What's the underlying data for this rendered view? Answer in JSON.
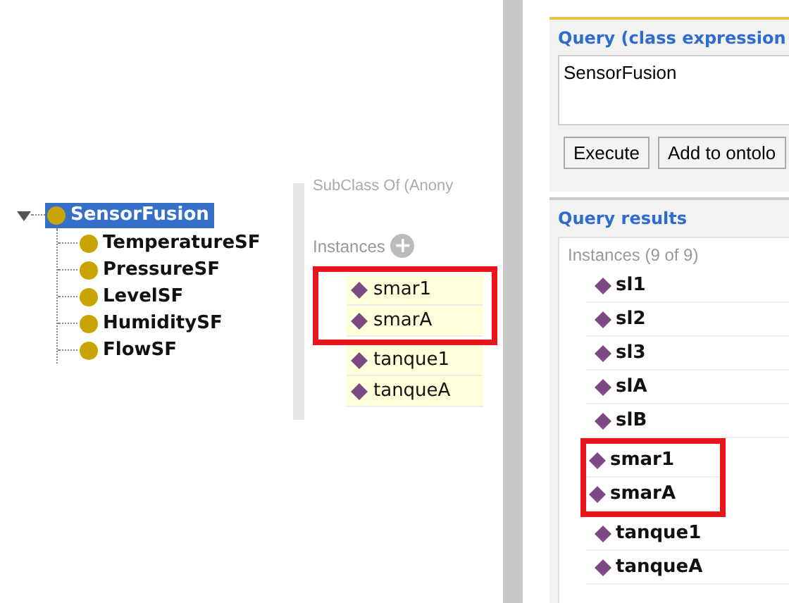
{
  "class_tree": {
    "root": {
      "label": "SensorFusion",
      "selected": true,
      "expanded": true,
      "children": [
        {
          "label": "TemperatureSF",
          "selected": false
        },
        {
          "label": "PressureSF",
          "selected": false
        },
        {
          "label": "LevelSF",
          "selected": false
        },
        {
          "label": "HumiditySF",
          "selected": false
        },
        {
          "label": "FlowSF",
          "selected": false
        }
      ]
    }
  },
  "description": {
    "subclass_heading": "SubClass Of (Anony",
    "instances_heading": "Instances",
    "add_button": "+",
    "instance_groups": [
      {
        "highlighted": true,
        "items": [
          "smar1",
          "smarA"
        ]
      },
      {
        "highlighted": false,
        "items": [
          "tanque1",
          "tanqueA"
        ]
      }
    ]
  },
  "dl_query": {
    "query_title": "Query (class expression",
    "query_text": "SensorFusion",
    "buttons": [
      "Execute",
      "Add to ontolo"
    ],
    "results_title": "Query results",
    "results_heading": "Instances (9 of 9)",
    "result_groups": [
      {
        "highlighted": false,
        "items": [
          "sl1",
          "sl2",
          "sl3",
          "slA",
          "slB"
        ]
      },
      {
        "highlighted": true,
        "items": [
          "smar1",
          "smarA"
        ]
      },
      {
        "highlighted": false,
        "items": [
          "tanque1",
          "tanqueA"
        ]
      }
    ]
  }
}
